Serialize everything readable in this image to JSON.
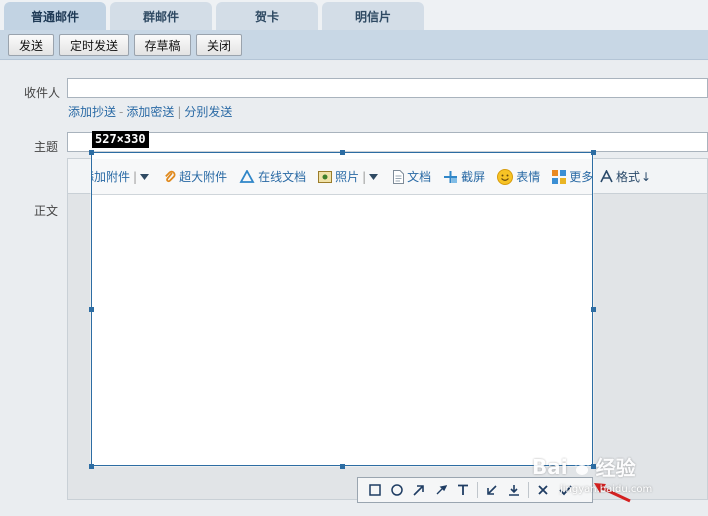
{
  "tabs": [
    {
      "label": "普通邮件",
      "active": true
    },
    {
      "label": "群邮件",
      "active": false
    },
    {
      "label": "贺卡",
      "active": false
    },
    {
      "label": "明信片",
      "active": false
    }
  ],
  "toolbar": {
    "send": "发送",
    "schedule_send": "定时发送",
    "save_draft": "存草稿",
    "close": "关闭"
  },
  "form": {
    "recipient_label": "收件人",
    "recipient_value": "",
    "add_cc": "添加抄送",
    "add_bcc": "添加密送",
    "separate_send": "分别发送",
    "link_sep1": "-",
    "link_sep2": "|",
    "subject_label": "主题",
    "subject_value": "",
    "body_label": "正文"
  },
  "editor_toolbar": {
    "add_attachment": "添加附件",
    "large_attachment": "超大附件",
    "online_doc": "在线文档",
    "photo": "照片",
    "doc": "文档",
    "screenshot": "截屏",
    "emoji": "表情",
    "more": "更多",
    "format": "格式"
  },
  "capture": {
    "size_label": "527×330"
  },
  "watermark": {
    "brand_left": "Bai",
    "brand_right": "经验",
    "url": "jingyan.baidu.com"
  },
  "colors": {
    "tab_active": "#c2d3e3",
    "toolbar_band": "#c8d7e5",
    "link": "#2a6aa5",
    "capture_border": "#2d6da3",
    "arrow_red": "#d42020"
  }
}
